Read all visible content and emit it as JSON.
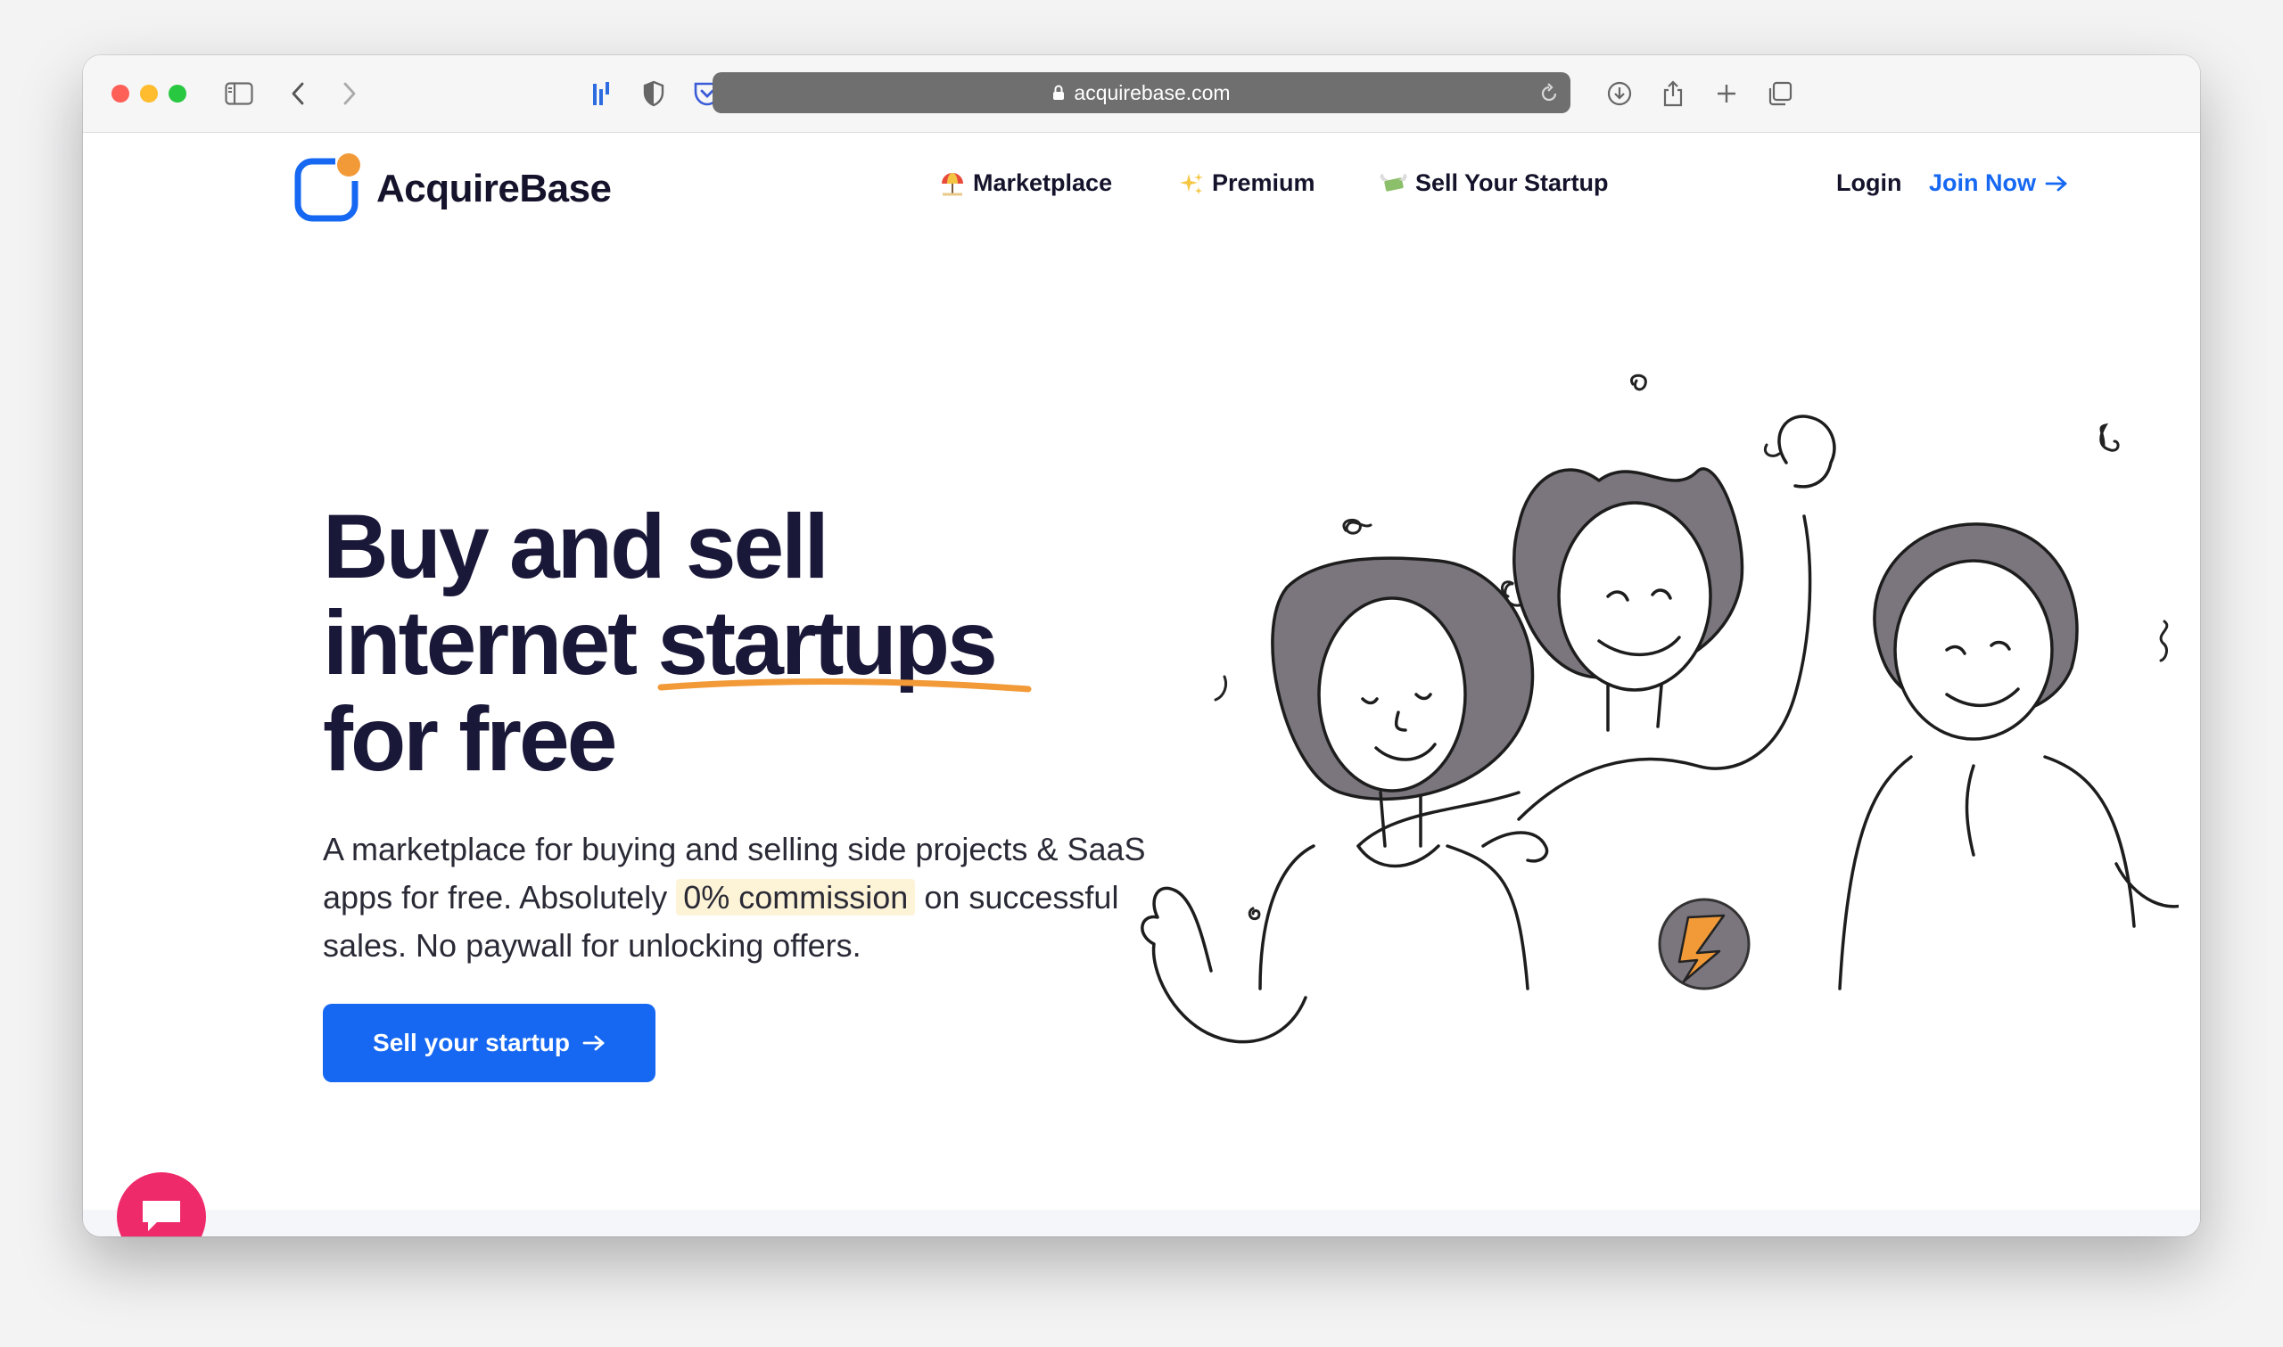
{
  "browser": {
    "url": "acquirebase.com"
  },
  "site": {
    "brand": "AcquireBase",
    "nav": [
      {
        "label": "Marketplace",
        "icon": "umbrella-icon"
      },
      {
        "label": "Premium",
        "icon": "sparkles-icon"
      },
      {
        "label": "Sell Your Startup",
        "icon": "money-wings-icon"
      }
    ],
    "login_label": "Login",
    "join_label": "Join Now",
    "accent_color": "#1668f2",
    "logo_accent_color": "#f29a38"
  },
  "hero": {
    "title_line1": "Buy and sell",
    "title_line2_a": "internet",
    "title_line2_b": "startups",
    "title_line3": "for free",
    "sub_part1": "A marketplace for buying and selling side projects & SaaS apps for free. Absolutely",
    "sub_highlight": "0% commission",
    "sub_part2": "on successful sales. No paywall for unlocking offers.",
    "cta_label": "Sell your startup"
  },
  "chat": {
    "icon": "chat-bubble-icon",
    "color": "#ee2a6b"
  }
}
